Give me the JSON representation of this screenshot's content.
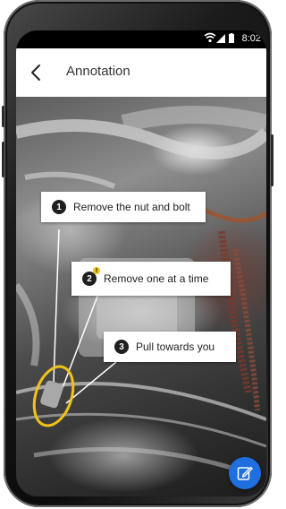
{
  "status_bar": {
    "time": "8:02"
  },
  "app_bar": {
    "title": "Annotation"
  },
  "annotations": [
    {
      "number": "1",
      "text": "Remove the nut and bolt"
    },
    {
      "number": "2",
      "text": "Remove one at a time",
      "warning": "!"
    },
    {
      "number": "3",
      "text": "Pull towards you"
    }
  ],
  "icons": {
    "back": "chevron-left-icon",
    "edit": "edit-icon",
    "wifi": "wifi-icon",
    "signal": "signal-icon",
    "battery": "battery-icon"
  },
  "colors": {
    "highlight": "#f1c21b",
    "fab": "#1f6fe0",
    "badge": "#1f1f1f"
  }
}
